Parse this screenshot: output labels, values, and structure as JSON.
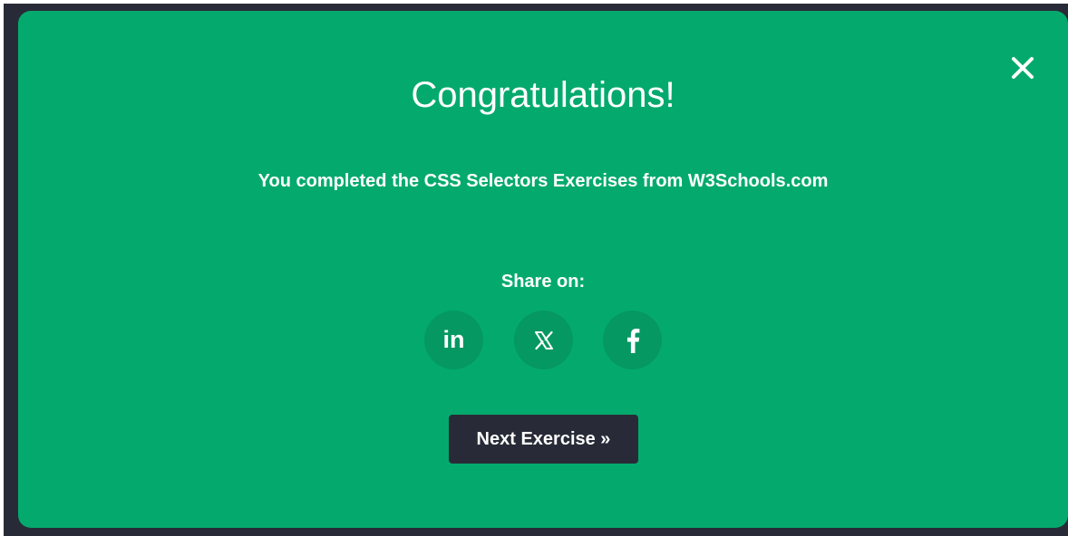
{
  "modal": {
    "title": "Congratulations!",
    "message": "You completed the CSS Selectors Exercises from W3Schools.com",
    "share_label": "Share on:",
    "share_buttons": [
      {
        "icon": "linkedin-icon",
        "glyph": "in"
      },
      {
        "icon": "x-icon"
      },
      {
        "icon": "facebook-icon"
      }
    ],
    "next_button_label": "Next Exercise »",
    "close_icon": "close-icon"
  },
  "colors": {
    "modal_background": "#04aa6d",
    "backdrop": "#282b37",
    "share_button_background": "#059862",
    "next_button_background": "#282b37",
    "text": "#ffffff"
  }
}
